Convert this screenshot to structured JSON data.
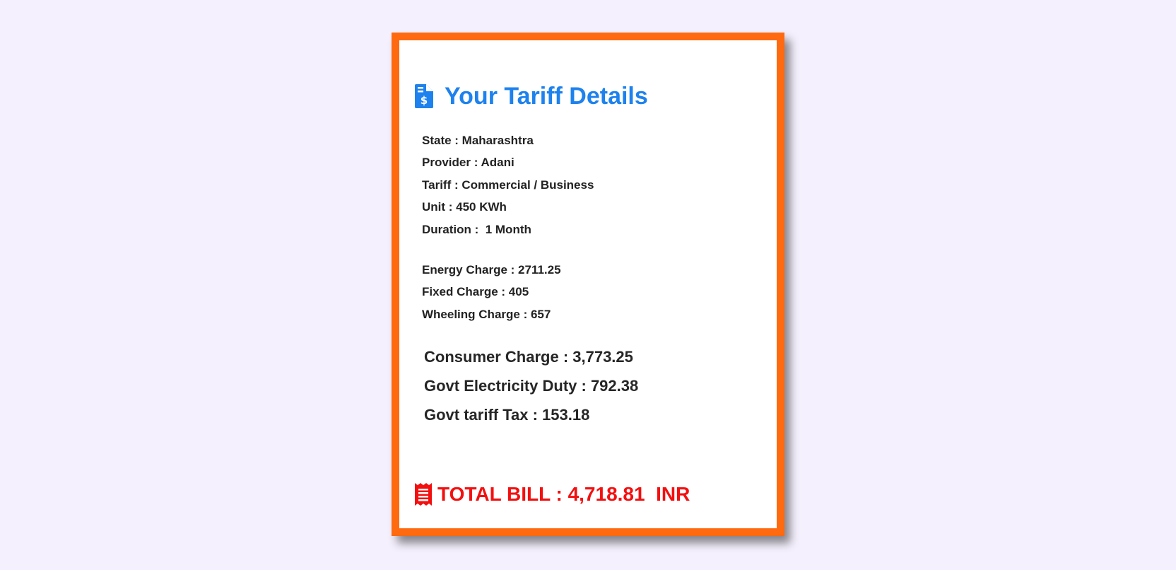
{
  "header": {
    "title": "Your Tariff Details",
    "icon": "invoice-dollar-icon",
    "color": "#1e82ee"
  },
  "details": {
    "state": "State : Maharashtra",
    "provider": "Provider : Adani",
    "tariff": "Tariff : Commercial / Business",
    "unit": "Unit : 450 KWh",
    "duration": "Duration :  1 Month"
  },
  "charges": {
    "energy": "Energy Charge : 2711.25",
    "fixed": "Fixed Charge : 405",
    "wheeling": "Wheeling Charge : 657"
  },
  "summary": {
    "consumer": "Consumer Charge : 3,773.25",
    "duty": "Govt Electricity Duty : 792.38",
    "tax": "Govt tariff Tax : 153.18"
  },
  "total": {
    "label": "TOTAL BILL : 4,718.81  INR",
    "icon": "receipt-icon",
    "color": "#f40f0f"
  },
  "theme": {
    "border": "#ff690f",
    "background": "#f5f0fd"
  }
}
